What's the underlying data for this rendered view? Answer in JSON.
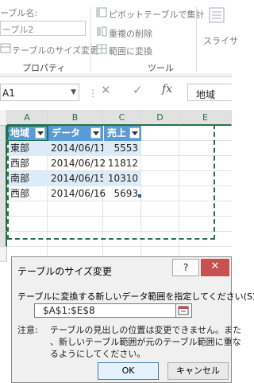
{
  "ribbon": {
    "table_name_label": "ーブル名:",
    "table_name_value": "ーブル2",
    "resize_table": "テーブルのサイズ変更",
    "summarize_pivot": "ピボットテーブルで集計",
    "remove_duplicates": "重複の削除",
    "convert_to_range": "範囲に変換",
    "slicer": "スライサ",
    "group_properties": "プロパティ",
    "group_tools": "ツール"
  },
  "formula_bar": {
    "name_box": "A1",
    "fx": "fx",
    "value": "地域"
  },
  "grid": {
    "columns": [
      "A",
      "B",
      "C",
      "D",
      "E"
    ],
    "headers": [
      "地域",
      "データ",
      "売上"
    ],
    "rows": [
      [
        "東部",
        "2014/06/11",
        "5553"
      ],
      [
        "西部",
        "2014/06/12",
        "11812"
      ],
      [
        "南部",
        "2014/06/15",
        "10310"
      ],
      [
        "西部",
        "2014/06/16",
        "5693"
      ]
    ]
  },
  "dialog": {
    "title": "テーブルのサイズ変更",
    "help": "?",
    "close": "✕",
    "prompt": "テーブルに変換する新しいデータ範囲を指定してください(S):",
    "range_value": "$A$1:$E$8",
    "note_label": "注意:",
    "note_lines": [
      "テーブルの見出しの位置は変更できません。また",
      "、新しいテーブル範囲が元のテーブル範囲に重な",
      "るようにしてください。"
    ],
    "ok": "OK",
    "cancel": "キャンセル"
  },
  "colors": {
    "table_header": "#5b9bd5",
    "table_band": "#ddebf7",
    "accent_green": "#217346",
    "close_red": "#c75050"
  }
}
